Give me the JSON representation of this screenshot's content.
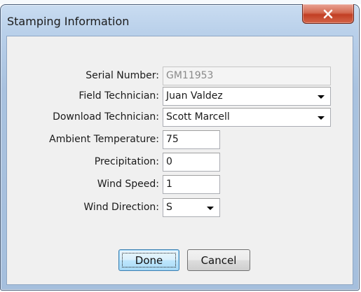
{
  "window": {
    "title": "Stamping Information",
    "close_glyph": "✕"
  },
  "form": {
    "serial_number": {
      "label": "Serial Number:",
      "value": "GM11953",
      "disabled": true
    },
    "field_technician": {
      "label": "Field Technician:",
      "value": "Juan Valdez"
    },
    "download_technician": {
      "label": "Download Technician:",
      "value": "Scott Marcell"
    },
    "ambient_temperature": {
      "label": "Ambient Temperature:",
      "value": "75"
    },
    "precipitation": {
      "label": "Precipitation:",
      "value": "0"
    },
    "wind_speed": {
      "label": "Wind Speed:",
      "value": "1"
    },
    "wind_direction": {
      "label": "Wind Direction:",
      "value": "S"
    }
  },
  "buttons": {
    "done": "Done",
    "cancel": "Cancel"
  },
  "colors": {
    "close_button": "#c23f24",
    "frame": "#b9d0ea",
    "client_bg": "#f0f0f0"
  }
}
